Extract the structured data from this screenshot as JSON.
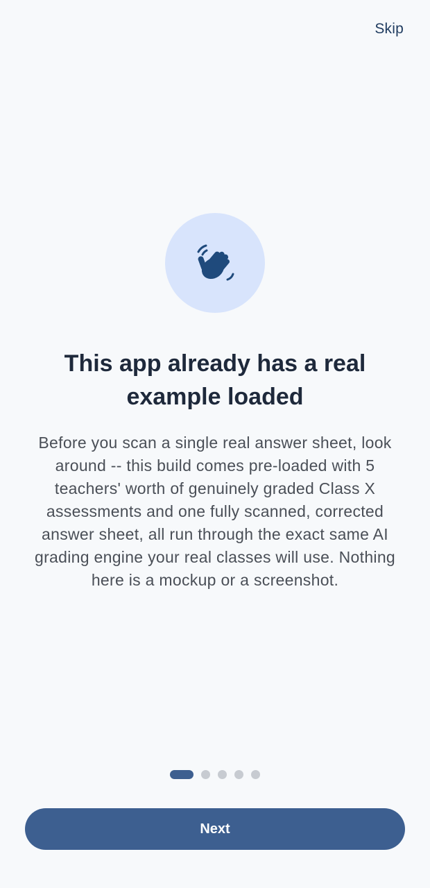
{
  "header": {
    "skip_label": "Skip"
  },
  "hero": {
    "icon": "waving-hand-icon",
    "circle_color": "#d8e4fc",
    "icon_color": "#1f4a7c"
  },
  "content": {
    "title": "This app already has a real example loaded",
    "body": "Before you scan a single real answer sheet, look around -- this build comes pre-loaded with 5 teachers' worth of genuinely graded Class X assessments and one fully scanned, corrected answer sheet, all run through the exact same AI grading engine your real classes will use. Nothing here is a mockup or a screenshot."
  },
  "pager": {
    "total": 5,
    "current": 1,
    "active_color": "#3d5f90",
    "inactive_color": "#c7cbd1"
  },
  "footer": {
    "next_label": "Next",
    "button_color": "#3d5f90"
  }
}
